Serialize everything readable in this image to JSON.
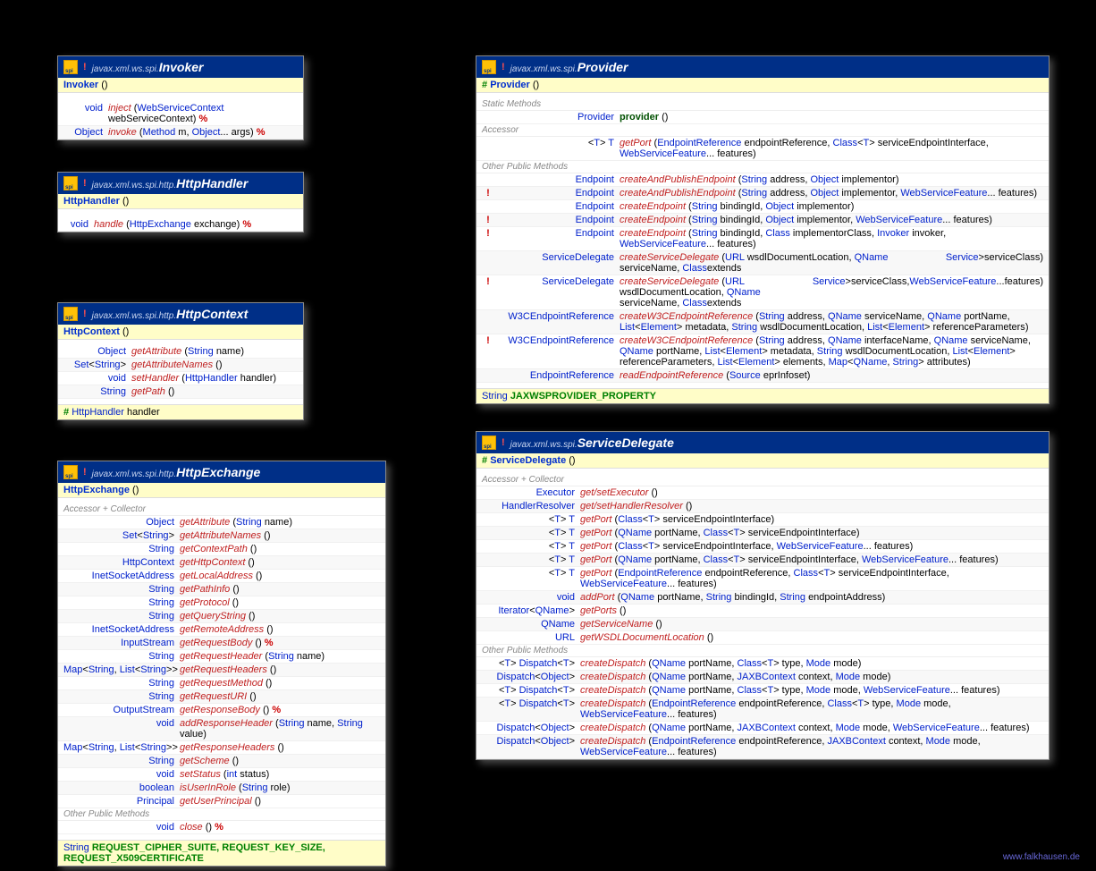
{
  "credit": "www.falkhausen.de",
  "boxes": {
    "invoker": {
      "package": "javax.xml.ws.spi.",
      "className": "Invoker",
      "abstract": true,
      "constructor": {
        "vis": "",
        "name": "Invoker",
        "params": "()"
      },
      "retWidth": 50,
      "methods": [
        {
          "flag": "",
          "ret": "void",
          "name": "inject",
          "sig": "(WebServiceContext webServiceContext)",
          "abs": true
        },
        {
          "flag": "",
          "ret": "Object",
          "name": "invoke",
          "sig": "(Method m, Object... args)",
          "abs": true
        }
      ]
    },
    "httpHandler": {
      "package": "javax.xml.ws.spi.http.",
      "className": "HttpHandler",
      "abstract": true,
      "constructor": {
        "vis": "",
        "name": "HttpHandler",
        "params": "()"
      },
      "retWidth": 34,
      "methods": [
        {
          "flag": "",
          "ret": "void",
          "name": "handle",
          "sig": "(HttpExchange exchange)",
          "abs": true
        }
      ]
    },
    "httpContext": {
      "package": "javax.xml.ws.spi.http.",
      "className": "HttpContext",
      "abstract": true,
      "constructor": {
        "vis": "",
        "name": "HttpContext",
        "params": "()"
      },
      "retWidth": 76,
      "methods": [
        {
          "flag": "",
          "ret": "Object",
          "name": "getAttribute",
          "sig": "(String name)"
        },
        {
          "flag": "",
          "ret": "Set<String>",
          "name": "getAttributeNames",
          "sig": "()"
        },
        {
          "flag": "",
          "ret": "void",
          "name": "setHandler",
          "sig": "(HttpHandler handler)"
        },
        {
          "flag": "",
          "ret": "String",
          "name": "getPath",
          "sig": "()"
        }
      ],
      "field": {
        "vis": "#",
        "type": "HttpHandler",
        "name": "handler"
      }
    },
    "httpExchange": {
      "package": "javax.xml.ws.spi.http.",
      "className": "HttpExchange",
      "abstract": true,
      "constructor": {
        "vis": "",
        "name": "HttpExchange",
        "params": "()"
      },
      "retWidth": 130,
      "section1": "Accessor + Collector",
      "methods": [
        {
          "ret": "Object",
          "name": "getAttribute",
          "sig": "(String name)"
        },
        {
          "ret": "Set<String>",
          "name": "getAttributeNames",
          "sig": "()"
        },
        {
          "ret": "String",
          "name": "getContextPath",
          "sig": "()"
        },
        {
          "ret": "HttpContext",
          "name": "getHttpContext",
          "sig": "()"
        },
        {
          "ret": "InetSocketAddress",
          "name": "getLocalAddress",
          "sig": "()"
        },
        {
          "ret": "String",
          "name": "getPathInfo",
          "sig": "()"
        },
        {
          "ret": "String",
          "name": "getProtocol",
          "sig": "()"
        },
        {
          "ret": "String",
          "name": "getQueryString",
          "sig": "()"
        },
        {
          "ret": "InetSocketAddress",
          "name": "getRemoteAddress",
          "sig": "()"
        },
        {
          "ret": "InputStream",
          "name": "getRequestBody",
          "sig": "()",
          "abs": true
        },
        {
          "ret": "String",
          "name": "getRequestHeader",
          "sig": "(String name)"
        },
        {
          "ret": "Map<String, List<String>>",
          "name": "getRequestHeaders",
          "sig": "()"
        },
        {
          "ret": "String",
          "name": "getRequestMethod",
          "sig": "()"
        },
        {
          "ret": "String",
          "name": "getRequestURI",
          "sig": "()"
        },
        {
          "ret": "OutputStream",
          "name": "getResponseBody",
          "sig": "()",
          "abs": true
        },
        {
          "ret": "void",
          "name": "addResponseHeader",
          "sig": "(String name, String value)"
        },
        {
          "ret": "Map<String, List<String>>",
          "name": "getResponseHeaders",
          "sig": "()"
        },
        {
          "ret": "String",
          "name": "getScheme",
          "sig": "()"
        },
        {
          "ret": "void",
          "name": "setStatus",
          "sig": "(int status)"
        },
        {
          "ret": "boolean",
          "name": "isUserInRole",
          "sig": "(String role)"
        },
        {
          "ret": "Principal",
          "name": "getUserPrincipal",
          "sig": "()"
        }
      ],
      "section2": "Other Public Methods",
      "methods2": [
        {
          "ret": "void",
          "name": "close",
          "sig": "()",
          "abs": true
        }
      ],
      "constants": {
        "type": "String",
        "names": "REQUEST_CIPHER_SUITE, REQUEST_KEY_SIZE, REQUEST_X509CERTIFICATE"
      }
    },
    "provider": {
      "package": "javax.xml.ws.spi.",
      "className": "Provider",
      "abstract": true,
      "constructor": {
        "vis": "#",
        "name": "Provider",
        "params": "()"
      },
      "retWidth": 140,
      "sectionStatic": "Static Methods",
      "staticMethods": [
        {
          "ret": "Provider",
          "name": "provider",
          "sig": "()",
          "static": true
        }
      ],
      "sectionAcc": "Accessor",
      "accMethods": [
        {
          "ret": "<T> T",
          "name": "getPort",
          "sig": "(EndpointReference endpointReference, Class<T> serviceEndpointInterface, WebServiceFeature... features)"
        }
      ],
      "sectionOther": "Other Public Methods",
      "otherMethods": [
        {
          "flag": "",
          "ret": "Endpoint",
          "name": "createAndPublishEndpoint",
          "sig": "(String address, Object implementor)"
        },
        {
          "flag": "!",
          "ret": "Endpoint",
          "name": "createAndPublishEndpoint",
          "sig": "(String address, Object implementor, WebServiceFeature... features)"
        },
        {
          "flag": "",
          "ret": "Endpoint",
          "name": "createEndpoint",
          "sig": "(String bindingId, Object implementor)"
        },
        {
          "flag": "!",
          "ret": "Endpoint",
          "name": "createEndpoint",
          "sig": "(String bindingId, Object implementor, WebServiceFeature... features)"
        },
        {
          "flag": "!",
          "ret": "Endpoint",
          "name": "createEndpoint",
          "sig": "(String bindingId, Class<?> implementorClass, Invoker invoker, WebServiceFeature... features)"
        },
        {
          "flag": "",
          "ret": "ServiceDelegate",
          "name": "createServiceDelegate",
          "sig": "(URL wsdlDocumentLocation, QName serviceName, Class<? extends Service> serviceClass)"
        },
        {
          "flag": "!",
          "ret": "ServiceDelegate",
          "name": "createServiceDelegate",
          "sig": "(URL wsdlDocumentLocation, QName serviceName, Class<? extends Service> serviceClass, WebServiceFeature... features)"
        },
        {
          "flag": "",
          "ret": "W3CEndpointReference",
          "name": "createW3CEndpointReference",
          "sig": "(String address, QName serviceName, QName portName, List<Element> metadata, String wsdlDocumentLocation, List<Element> referenceParameters)"
        },
        {
          "flag": "!",
          "ret": "W3CEndpointReference",
          "name": "createW3CEndpointReference",
          "sig": "(String address, QName interfaceName, QName serviceName, QName portName, List<Element> metadata, String wsdlDocumentLocation, List<Element> referenceParameters, List<Element> elements, Map<QName, String> attributes)"
        },
        {
          "flag": "",
          "ret": "EndpointReference",
          "name": "readEndpointReference",
          "sig": "(Source eprInfoset)"
        }
      ],
      "constants": {
        "type": "String",
        "names": "JAXWSPROVIDER_PROPERTY"
      }
    },
    "serviceDelegate": {
      "package": "javax.xml.ws.spi.",
      "className": "ServiceDelegate",
      "abstract": true,
      "constructor": {
        "vis": "#",
        "name": "ServiceDelegate",
        "params": "()"
      },
      "retWidth": 110,
      "section1": "Accessor + Collector",
      "methods": [
        {
          "ret": "Executor",
          "name": "get/setExecutor",
          "sig": "()"
        },
        {
          "ret": "HandlerResolver",
          "name": "get/setHandlerResolver",
          "sig": "()"
        },
        {
          "ret": "<T> T",
          "name": "getPort",
          "sig": "(Class<T> serviceEndpointInterface)"
        },
        {
          "ret": "<T> T",
          "name": "getPort",
          "sig": "(QName portName, Class<T> serviceEndpointInterface)"
        },
        {
          "ret": "<T> T",
          "name": "getPort",
          "sig": "(Class<T> serviceEndpointInterface, WebServiceFeature... features)"
        },
        {
          "ret": "<T> T",
          "name": "getPort",
          "sig": "(QName portName, Class<T> serviceEndpointInterface, WebServiceFeature... features)"
        },
        {
          "ret": "<T> T",
          "name": "getPort",
          "sig": "(EndpointReference endpointReference, Class<T> serviceEndpointInterface, WebServiceFeature... features)"
        },
        {
          "ret": "void",
          "name": "addPort",
          "sig": "(QName portName, String bindingId, String endpointAddress)"
        },
        {
          "ret": "Iterator<QName>",
          "name": "getPorts",
          "sig": "()"
        },
        {
          "ret": "QName",
          "name": "getServiceName",
          "sig": "()"
        },
        {
          "ret": "URL",
          "name": "getWSDLDocumentLocation",
          "sig": "()"
        }
      ],
      "section2": "Other Public Methods",
      "methods2": [
        {
          "ret": "<T> Dispatch<T>",
          "name": "createDispatch",
          "sig": "(QName portName, Class<T> type, Mode mode)"
        },
        {
          "ret": "Dispatch<Object>",
          "name": "createDispatch",
          "sig": "(QName portName, JAXBContext context, Mode mode)"
        },
        {
          "ret": "<T> Dispatch<T>",
          "name": "createDispatch",
          "sig": "(QName portName, Class<T> type, Mode mode, WebServiceFeature... features)"
        },
        {
          "ret": "<T> Dispatch<T>",
          "name": "createDispatch",
          "sig": "(EndpointReference endpointReference, Class<T> type, Mode mode, WebServiceFeature... features)"
        },
        {
          "ret": "Dispatch<Object>",
          "name": "createDispatch",
          "sig": "(QName portName, JAXBContext context, Mode mode, WebServiceFeature... features)"
        },
        {
          "ret": "Dispatch<Object>",
          "name": "createDispatch",
          "sig": "(EndpointReference endpointReference, JAXBContext context, Mode mode, WebServiceFeature... features)"
        }
      ]
    }
  }
}
